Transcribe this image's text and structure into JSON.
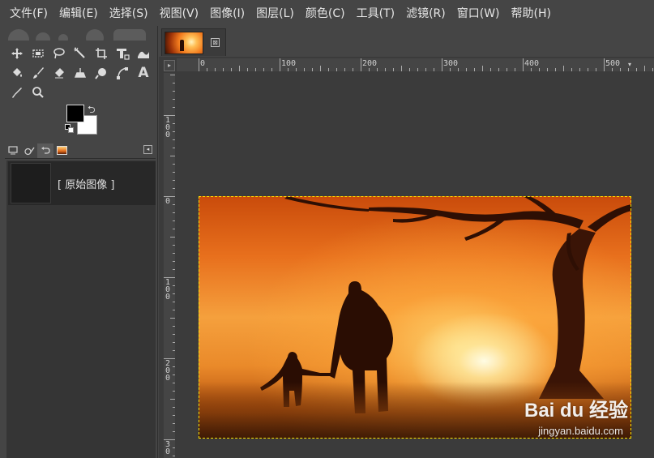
{
  "menu": [
    "文件(F)",
    "编辑(E)",
    "选择(S)",
    "视图(V)",
    "图像(I)",
    "图层(L)",
    "颜色(C)",
    "工具(T)",
    "滤镜(R)",
    "窗口(W)",
    "帮助(H)"
  ],
  "toolbox": {
    "tools": [
      [
        "move-icon",
        "rect-select-icon",
        "lasso-icon",
        "fuzzy-select-icon",
        "crop-icon",
        "unified-transform-icon",
        "warp-transform-icon"
      ],
      [
        "bucket-fill-icon",
        "paintbrush-icon",
        "eraser-icon",
        "clone-icon",
        "smudge-icon",
        "paths-icon",
        "text-icon"
      ],
      [
        "color-picker-icon",
        "zoom-icon"
      ]
    ],
    "text_tool_glyph": "A",
    "foreground_color": "#000000",
    "background_color": "#ffffff"
  },
  "dock": {
    "tabs": [
      "tool-options-tab",
      "device-status-tab",
      "undo-history-tab",
      "images-tab"
    ],
    "undo_history": [
      {
        "label": "[ 原始图像 ]"
      }
    ]
  },
  "image_window": {
    "tab_close": "⊠",
    "hruler_labels": [
      "0",
      "100",
      "200",
      "300",
      "400",
      "500"
    ],
    "vruler_labels": [
      "1\n0\n0",
      "0",
      "1\n0\n0",
      "2\n0\n0",
      "3\n0"
    ],
    "watermark": "Bai du 经验",
    "watermark_url": "jingyan.baidu.com"
  }
}
